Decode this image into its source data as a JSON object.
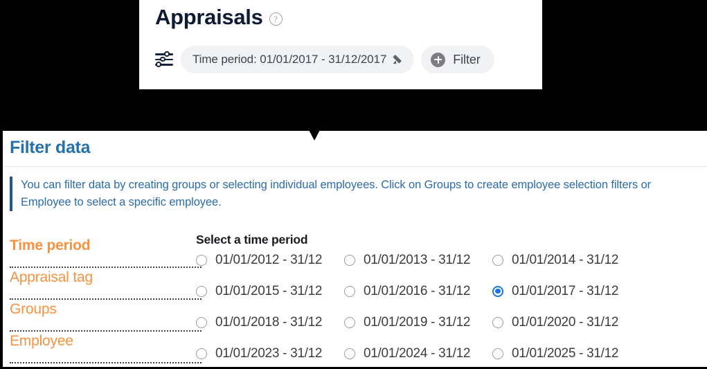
{
  "header": {
    "title": "Appraisals",
    "help_icon": "help-circle-icon",
    "sliders_icon": "sliders-icon",
    "time_period_chip": {
      "label": "Time period: 01/01/2017 - 31/12/2017",
      "edit_icon": "pencil-icon"
    },
    "filter_button": {
      "label": "Filter",
      "icon": "plus-circle-icon"
    }
  },
  "panel": {
    "title": "Filter data",
    "caret_icon": "caret-down-icon",
    "info_text": "You can filter data by creating groups or selecting individual employees. Click on Groups to create employee selection filters or Employee to select a specific employee.",
    "tabs": [
      {
        "label": "Time period",
        "active": true
      },
      {
        "label": "Appraisal tag",
        "active": false
      },
      {
        "label": "Groups",
        "active": false
      },
      {
        "label": "Employee",
        "active": false
      }
    ],
    "time_period": {
      "section_title": "Select a time period",
      "options": [
        {
          "label": "01/01/2012 - 31/12",
          "selected": false
        },
        {
          "label": "01/01/2013 - 31/12",
          "selected": false
        },
        {
          "label": "01/01/2014 - 31/12",
          "selected": false
        },
        {
          "label": "01/01/2015 - 31/12",
          "selected": false
        },
        {
          "label": "01/01/2016 - 31/12",
          "selected": false
        },
        {
          "label": "01/01/2017 - 31/12",
          "selected": true
        },
        {
          "label": "01/01/2018 - 31/12",
          "selected": false
        },
        {
          "label": "01/01/2019 - 31/12",
          "selected": false
        },
        {
          "label": "01/01/2020 - 31/12",
          "selected": false
        },
        {
          "label": "01/01/2023 - 31/12",
          "selected": false
        },
        {
          "label": "01/01/2024 - 31/12",
          "selected": false
        },
        {
          "label": "01/01/2025 - 31/12",
          "selected": false
        }
      ]
    }
  },
  "colors": {
    "title_navy": "#0f1b34",
    "panel_title_blue": "#2471ad",
    "info_blue": "#2b6ca8",
    "tab_orange": "#f89240",
    "radio_selected_blue": "#1a73e8",
    "chip_grey": "#f1f2f4"
  }
}
